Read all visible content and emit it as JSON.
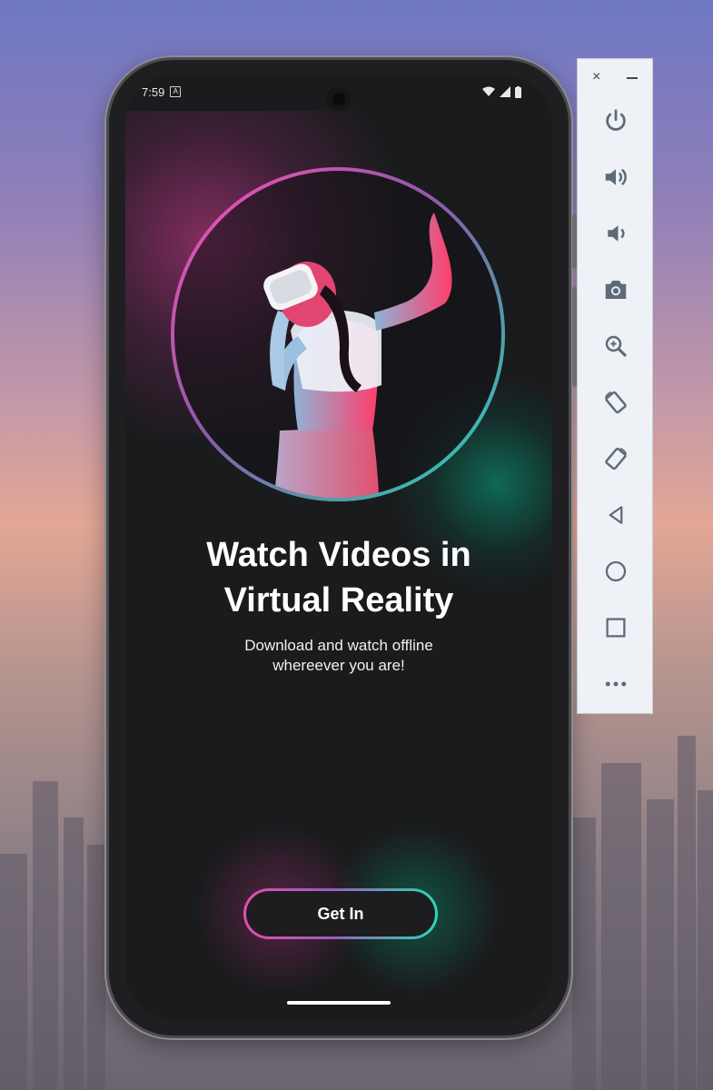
{
  "status_bar": {
    "time": "7:59",
    "notification_icon": "A"
  },
  "onboarding": {
    "title_line1": "Watch Videos in",
    "title_line2": "Virtual Reality",
    "subtitle_line1": "Download and watch offline",
    "subtitle_line2": "whereever you are!",
    "cta_label": "Get In",
    "accent_pink": "#e84cae",
    "accent_teal": "#2ad7b8",
    "background": "#1a1b1d"
  },
  "emulator_toolbar": {
    "close_symbol": "×",
    "buttons": [
      "power-icon",
      "volume-up-icon",
      "volume-down-icon",
      "camera-icon",
      "zoom-icon",
      "rotate-left-icon",
      "rotate-right-icon",
      "back-icon",
      "home-icon",
      "overview-icon",
      "more-icon"
    ]
  }
}
